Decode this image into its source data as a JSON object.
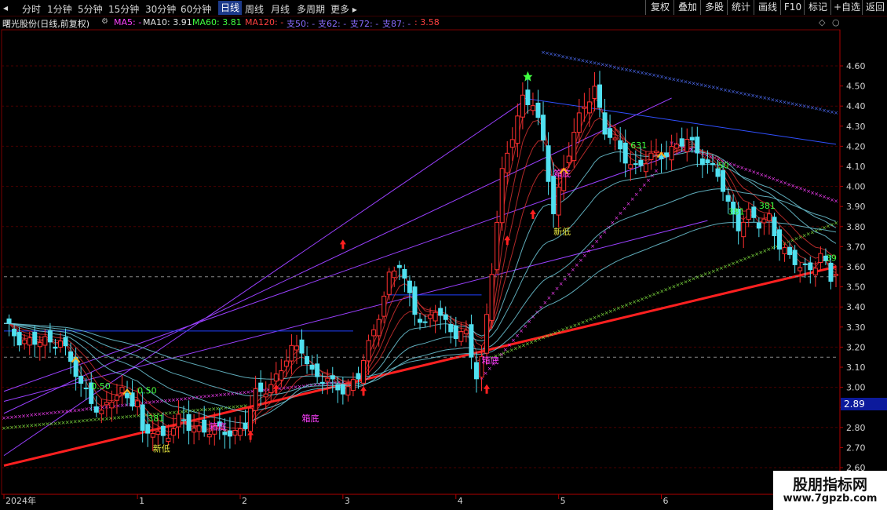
{
  "toolbar": {
    "periods": [
      "分时",
      "1分钟",
      "5分钟",
      "15分钟",
      "30分钟",
      "60分钟",
      "日线",
      "周线",
      "月线",
      "多周期",
      "更多"
    ],
    "active_period": "日线",
    "right_buttons": [
      "复权",
      "叠加",
      "多股",
      "统计",
      "画线",
      "F10",
      "标记",
      "+自选",
      "返回"
    ]
  },
  "info": {
    "stock_label": "曙光股份(日线,前复权)",
    "ma5": "MA5: -",
    "ma10": "MA10: 3.91",
    "ma60": "MA60: 3.81",
    "ma120": "MA120: -",
    "zhi50": "支50: -",
    "zhi62": "支62: -",
    "zhi72": "支72: -",
    "zhi87": "支87: -",
    "last": ": 3.58",
    "colors": {
      "ma5": "#ff40ff",
      "ma10": "#e0e0e0",
      "ma60": "#40ff40",
      "ma120": "#ff4040",
      "zhi": "#8a6cff",
      "last": "#ff4040"
    }
  },
  "watermark": {
    "title": "股朋指标网",
    "url": "www.7gpzb.com"
  },
  "current_price_tag": "2.89",
  "chart_data": {
    "type": "candlestick",
    "x_ticks": [
      "2024年",
      "1",
      "2",
      "3",
      "4",
      "5",
      "6"
    ],
    "x_tick_index": [
      0,
      26,
      46,
      66,
      88,
      108,
      128
    ],
    "y_ticks": [
      "2.60",
      "2.70",
      "2.80",
      "2.90",
      "3.00",
      "3.10",
      "3.20",
      "3.30",
      "3.40",
      "3.50",
      "3.60",
      "3.70",
      "3.80",
      "3.90",
      "4.00",
      "4.10",
      "4.20",
      "4.30",
      "4.40",
      "4.50",
      "4.60"
    ],
    "ylim": [
      2.55,
      4.72
    ],
    "y_min_tick": 2.6,
    "y_max_tick": 4.6,
    "last_index": 162,
    "closes": [
      [
        0,
        3.3
      ],
      [
        3,
        3.25
      ],
      [
        6,
        3.22
      ],
      [
        9,
        3.22
      ],
      [
        11,
        3.25
      ],
      [
        13,
        3.12
      ],
      [
        15,
        3.0
      ],
      [
        17,
        2.95
      ],
      [
        19,
        2.87
      ],
      [
        21,
        2.93
      ],
      [
        23,
        2.98
      ],
      [
        26,
        2.93
      ],
      [
        27,
        2.75
      ],
      [
        29,
        2.78
      ],
      [
        31,
        2.76
      ],
      [
        34,
        2.83
      ],
      [
        36,
        2.8
      ],
      [
        39,
        2.8
      ],
      [
        42,
        2.77
      ],
      [
        45,
        2.78
      ],
      [
        47,
        2.82
      ],
      [
        49,
        2.95
      ],
      [
        52,
        3.02
      ],
      [
        54,
        3.1
      ],
      [
        56,
        3.17
      ],
      [
        58,
        3.2
      ],
      [
        60,
        3.08
      ],
      [
        62,
        3.03
      ],
      [
        64,
        3.01
      ],
      [
        67,
        3.0
      ],
      [
        69,
        3.05
      ],
      [
        71,
        3.2
      ],
      [
        73,
        3.38
      ],
      [
        75,
        3.55
      ],
      [
        77,
        3.6
      ],
      [
        78,
        3.52
      ],
      [
        80,
        3.4
      ],
      [
        82,
        3.3
      ],
      [
        84,
        3.38
      ],
      [
        86,
        3.32
      ],
      [
        88,
        3.28
      ],
      [
        90,
        3.25
      ],
      [
        92,
        3.05
      ],
      [
        93,
        3.14
      ],
      [
        95,
        3.6
      ],
      [
        97,
        4.05
      ],
      [
        99,
        4.25
      ],
      [
        101,
        4.45
      ],
      [
        103,
        4.42
      ],
      [
        105,
        4.2
      ],
      [
        107,
        3.88
      ],
      [
        109,
        4.1
      ],
      [
        111,
        4.25
      ],
      [
        113,
        4.4
      ],
      [
        115,
        4.5
      ],
      [
        117,
        4.28
      ],
      [
        119,
        4.2
      ],
      [
        121,
        4.15
      ],
      [
        123,
        4.1
      ],
      [
        125,
        4.12
      ],
      [
        127,
        4.15
      ],
      [
        129,
        4.18
      ],
      [
        131,
        4.2
      ],
      [
        133,
        4.22
      ],
      [
        135,
        4.18
      ],
      [
        137,
        4.12
      ],
      [
        139,
        4.05
      ],
      [
        141,
        3.9
      ],
      [
        143,
        3.82
      ],
      [
        145,
        3.86
      ],
      [
        147,
        3.8
      ],
      [
        149,
        3.85
      ],
      [
        151,
        3.72
      ],
      [
        153,
        3.63
      ],
      [
        155,
        3.6
      ],
      [
        157,
        3.6
      ],
      [
        159,
        3.66
      ],
      [
        161,
        3.52
      ],
      [
        162,
        3.58
      ]
    ],
    "annotations": [
      {
        "text": "箱底",
        "i": 58,
        "price": 2.83,
        "color": "#ff40ff"
      },
      {
        "text": "箱底",
        "i": 40,
        "price": 2.79,
        "color": "#ff40ff"
      },
      {
        "text": "箱底",
        "i": 93,
        "price": 3.12,
        "color": "#ff40ff"
      },
      {
        "text": "箱底",
        "i": 107,
        "price": 4.05,
        "color": "#ff40ff"
      },
      {
        "text": "新低",
        "i": 29,
        "price": 2.68,
        "color": "#e8e840"
      },
      {
        "text": "新低",
        "i": 107,
        "price": 3.76,
        "color": "#e8e840"
      },
      {
        "text": "0.50",
        "i": 17,
        "price": 2.99,
        "color": "#40ff40"
      },
      {
        "text": "0.50",
        "i": 26,
        "price": 2.97,
        "color": "#40ff40"
      },
      {
        "text": "381",
        "i": 28,
        "price": 2.83,
        "color": "#40ff40"
      },
      {
        "text": "631",
        "i": 122,
        "price": 4.19,
        "color": "#40ff40"
      },
      {
        "text": "50",
        "i": 139,
        "price": 4.09,
        "color": "#40ff40"
      },
      {
        "text": "381",
        "i": 141,
        "price": 3.86,
        "color": "#40ff40"
      },
      {
        "text": "381",
        "i": 147,
        "price": 3.89,
        "color": "#40ff40"
      },
      {
        "text": "39",
        "i": 160,
        "price": 3.63,
        "color": "#40ff40"
      }
    ],
    "up_arrows": [
      [
        48,
        2.75
      ],
      [
        53,
        2.98
      ],
      [
        70,
        2.97
      ],
      [
        94,
        2.98
      ],
      [
        98,
        3.72
      ],
      [
        103,
        3.85
      ],
      [
        66,
        3.7
      ]
    ],
    "down_markers": [
      [
        14,
        3.14
      ],
      [
        24,
        2.98
      ],
      [
        109,
        4.08
      ],
      [
        128,
        4.16
      ]
    ],
    "lines": [
      {
        "name": "main-support",
        "color": "#ff2020",
        "width": 3,
        "from": [
          0,
          2.61
        ],
        "to": [
          162,
          3.6
        ]
      },
      {
        "name": "fan-1",
        "color": "#9a40ff",
        "width": 1,
        "from": [
          0,
          2.66
        ],
        "to": [
          101,
          4.42
        ]
      },
      {
        "name": "fan-2",
        "color": "#9a40ff",
        "width": 1,
        "from": [
          0,
          2.87
        ],
        "to": [
          130,
          4.44
        ]
      },
      {
        "name": "fan-3",
        "color": "#9a40ff",
        "width": 1,
        "from": [
          0,
          2.98
        ],
        "to": [
          135,
          4.2
        ]
      },
      {
        "name": "fan-4",
        "color": "#9a40ff",
        "width": 1,
        "from": [
          0,
          2.93
        ],
        "to": [
          137,
          3.83
        ]
      },
      {
        "name": "resistance-blue",
        "color": "#3050ff",
        "width": 1,
        "from": [
          101,
          4.44
        ],
        "to": [
          162,
          4.21
        ]
      },
      {
        "name": "box-top-1",
        "color": "#2040ff",
        "width": 1,
        "from": [
          0,
          3.28
        ],
        "to": [
          68,
          3.28
        ]
      },
      {
        "name": "box-top-2",
        "color": "#2040ff",
        "width": 1,
        "from": [
          75,
          3.46
        ],
        "to": [
          93,
          3.46
        ]
      },
      {
        "name": "dash-3.55",
        "color": "#888888",
        "width": 1,
        "dash": true,
        "from": [
          0,
          3.55
        ],
        "to": [
          162,
          3.55
        ]
      },
      {
        "name": "dash-3.15",
        "color": "#888888",
        "width": 1,
        "dash": true,
        "from": [
          0,
          3.15
        ],
        "to": [
          162,
          3.15
        ]
      }
    ],
    "dotted": [
      {
        "color": "#ff40ff",
        "from": [
          0,
          2.85
        ],
        "to": [
          66,
          3.03
        ]
      },
      {
        "color": "#ff40ff",
        "from": [
          93,
          3.05
        ],
        "to": [
          127,
          4.08
        ]
      },
      {
        "color": "#ff40ff",
        "from": [
          130,
          4.22
        ],
        "to": [
          162,
          3.93
        ]
      },
      {
        "color": "#80e040",
        "from": [
          0,
          2.8
        ],
        "to": [
          47,
          2.91
        ]
      },
      {
        "color": "#80e040",
        "from": [
          95,
          3.15
        ],
        "to": [
          162,
          3.82
        ]
      },
      {
        "color": "#5070ff",
        "from": [
          105,
          4.67
        ],
        "to": [
          162,
          4.37
        ]
      }
    ]
  }
}
